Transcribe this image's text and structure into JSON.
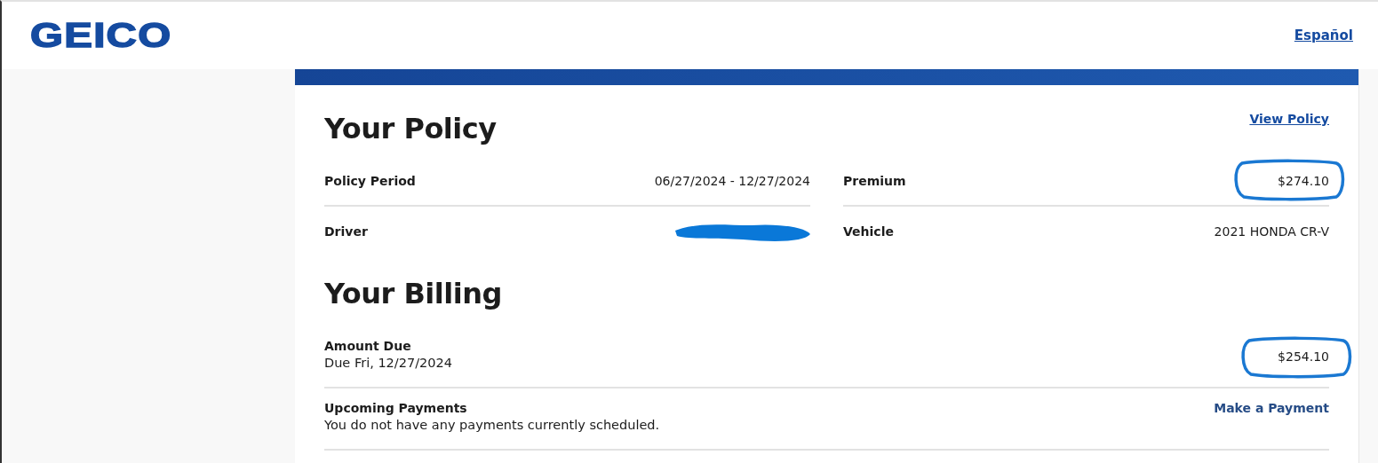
{
  "header": {
    "logo": "GEICO",
    "language_link": "Español"
  },
  "policy": {
    "title": "Your Policy",
    "link": "View Policy",
    "fields": [
      {
        "label": "Policy Period",
        "value": "06/27/2024 - 12/27/2024"
      },
      {
        "label": "Premium",
        "value": "$274.10",
        "circled": true
      },
      {
        "label": "Driver",
        "redacted": true
      },
      {
        "label": "Vehicle",
        "value": "2021 HONDA CR-V"
      }
    ]
  },
  "billing": {
    "title": "Your Billing",
    "rows": [
      {
        "label": "Amount Due",
        "detail": "Due Fri, 12/27/2024",
        "value": "$254.10",
        "circled": true
      },
      {
        "label": "Upcoming Payments",
        "detail": "You do not have any payments currently scheduled.",
        "link": "Make a Payment"
      }
    ]
  }
}
